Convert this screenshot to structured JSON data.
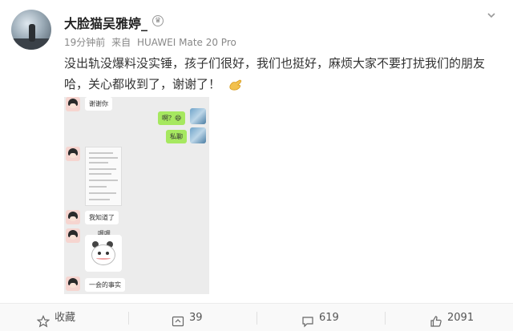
{
  "post": {
    "username": "大脸猫吴雅婷_",
    "time": "19分钟前",
    "source_prefix": "来自",
    "source_device": "HUAWEI Mate 20 Pro",
    "text_line1": "没出轨没爆料没实锤，孩子们很好，我们也挺好，麻烦大家不要打扰我们的朋友",
    "text_line2": "哈，关心都收到了，谢谢了！",
    "icons": [
      "vip-badge-icon",
      "chevron-down-icon",
      "clap-icon"
    ]
  },
  "screenshot_chat": {
    "messages": [
      {
        "side": "left",
        "text": "谢谢你"
      },
      {
        "side": "right",
        "text": "啊？😄"
      },
      {
        "side": "right",
        "text": "私聊"
      },
      {
        "side": "left",
        "text": "[图片]"
      },
      {
        "side": "left",
        "text": "我知道了"
      },
      {
        "side": "left",
        "text": "嗯嗯"
      },
      {
        "side": "left",
        "text": "一会的事实"
      }
    ],
    "bubble_color_right": "#a6e860",
    "bubble_color_left": "#ffffff"
  },
  "footer": {
    "favorite_label": "收藏",
    "repost_count": "39",
    "comment_count": "619",
    "like_count": "2091"
  },
  "colors": {
    "text_main": "#333333",
    "text_meta": "#888888",
    "footer_bg": "#f9f9f9"
  }
}
